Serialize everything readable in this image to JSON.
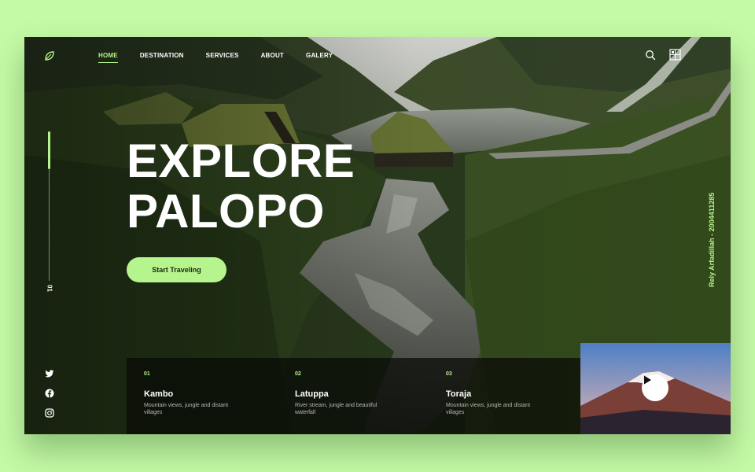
{
  "nav": {
    "items": [
      {
        "label": "HOME",
        "active": true
      },
      {
        "label": "DESTINATION",
        "active": false
      },
      {
        "label": "SERVICES",
        "active": false
      },
      {
        "label": "ABOUT",
        "active": false
      },
      {
        "label": "GALERY",
        "active": false
      }
    ]
  },
  "icons": {
    "logo": "leaf-icon",
    "search": "search-icon",
    "gallery": "gallery-icon",
    "socials": [
      "twitter-icon",
      "facebook-icon",
      "instagram-icon"
    ],
    "video": "play-icon"
  },
  "hero": {
    "title_line1": "EXPLORE",
    "title_line2": "PALOPO",
    "cta": "Start Traveling"
  },
  "slider": {
    "current": "01",
    "progress": 0.25
  },
  "author": "Rely Arfadillah - 2004411285",
  "destinations": [
    {
      "num": "01",
      "title": "Kambo",
      "desc": "Mountain views, jungle and distant villages"
    },
    {
      "num": "02",
      "title": "Latuppa",
      "desc": "River stream, jungle and beautiful waterfall"
    },
    {
      "num": "03",
      "title": "Toraja",
      "desc": "Mountain views, jungle and distant villages"
    }
  ],
  "colors": {
    "accent": "#b6f48d",
    "page_background": "#c4f9a6",
    "card_background": "#0a0c08"
  }
}
